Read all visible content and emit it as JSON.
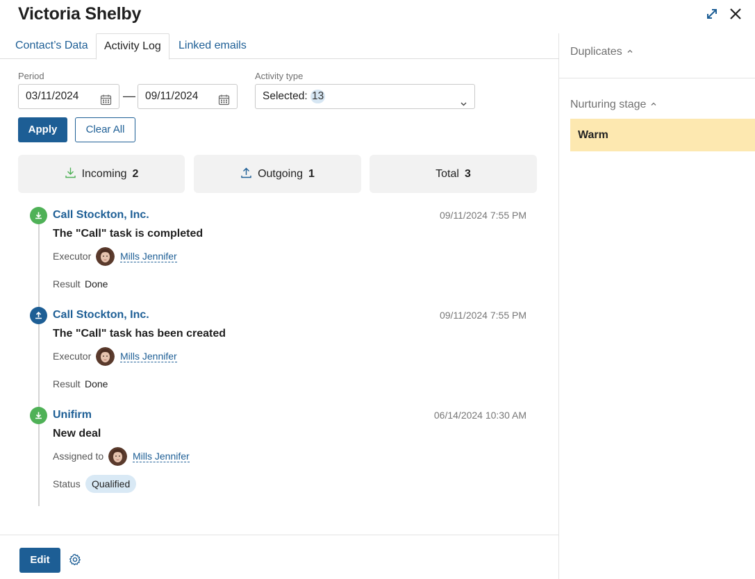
{
  "header": {
    "title": "Victoria Shelby"
  },
  "tabs": [
    {
      "label": "Contact’s Data"
    },
    {
      "label": "Activity Log"
    },
    {
      "label": "Linked emails"
    }
  ],
  "filters": {
    "period_label": "Period",
    "date_from": "03/11/2024",
    "date_separator": "—",
    "date_to": "09/11/2024",
    "activity_type_label": "Activity type",
    "selected_prefix": "Selected:",
    "selected_count": "13",
    "apply_label": "Apply",
    "clear_label": "Clear All"
  },
  "stats": [
    {
      "label": "Incoming",
      "count": "2"
    },
    {
      "label": "Outgoing",
      "count": "1"
    },
    {
      "label": "Total",
      "count": "3"
    }
  ],
  "entries": [
    {
      "direction": "incoming",
      "title": "Call Stockton, Inc.",
      "date": "09/11/2024 7:55 PM",
      "subtitle": "The \"Call\" task is completed",
      "person_label": "Executor",
      "person": "Mills Jennifer",
      "field_label": "Result",
      "field_value": "Done"
    },
    {
      "direction": "outgoing",
      "title": "Call Stockton, Inc.",
      "date": "09/11/2024 7:55 PM",
      "subtitle": "The \"Call\" task has been created",
      "person_label": "Executor",
      "person": "Mills Jennifer",
      "field_label": "Result",
      "field_value": "Done"
    },
    {
      "direction": "incoming",
      "title": "Unifirm",
      "date": "06/14/2024 10:30 AM",
      "subtitle": "New deal",
      "person_label": "Assigned to",
      "person": "Mills Jennifer",
      "field_label": "Status",
      "field_value": "Qualified"
    }
  ],
  "footer": {
    "edit_label": "Edit"
  },
  "sidebar": {
    "duplicates_label": "Duplicates",
    "nurturing_label": "Nurturing stage",
    "stage_value": "Warm"
  },
  "colors": {
    "accent": "#1d5e95",
    "incoming": "#4fb157",
    "stage_bg": "#fde8b0",
    "badge_bg": "#d9e9f5"
  }
}
